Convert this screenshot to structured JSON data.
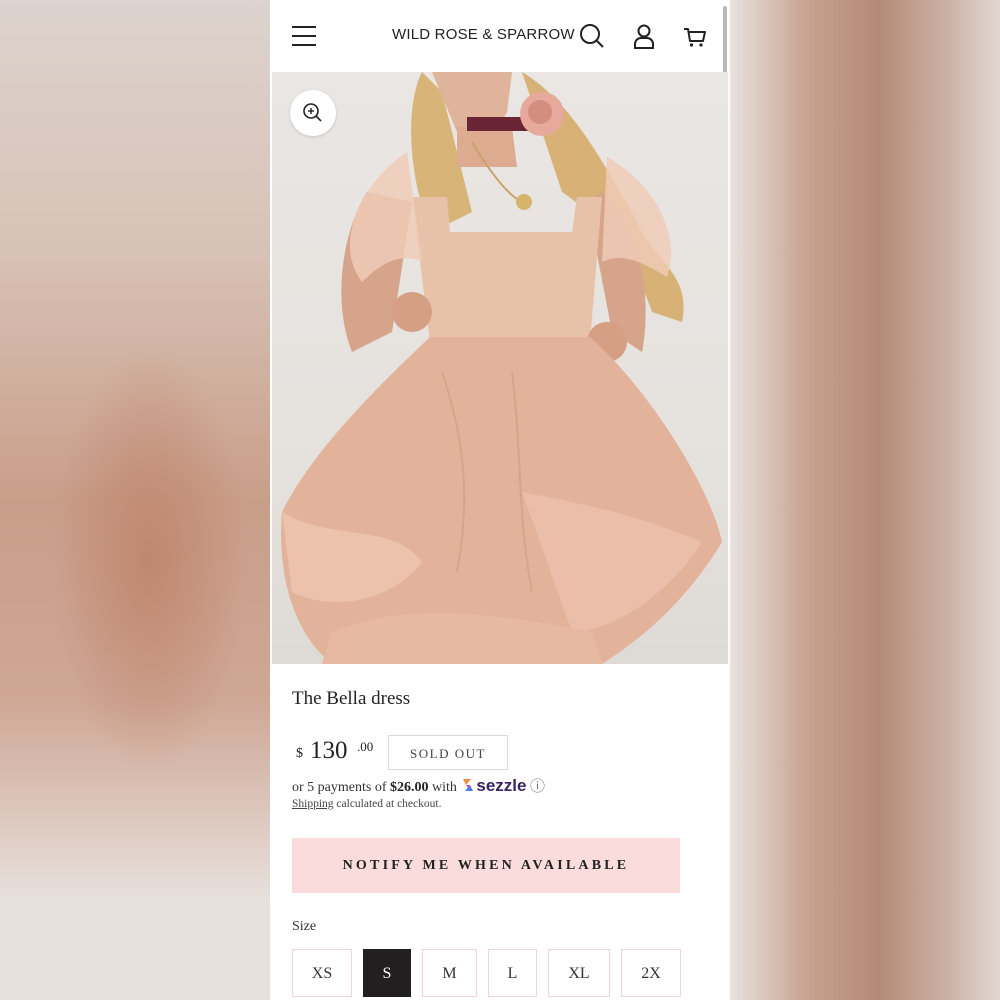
{
  "header": {
    "brand": "WILD ROSE & SPARROW",
    "menu_icon": "hamburger-menu-icon",
    "search_icon": "search-icon",
    "account_icon": "user-icon",
    "cart_icon": "cart-icon"
  },
  "product": {
    "title": "The Bella dress",
    "price_currency": "$",
    "price_whole": "130",
    "price_cents": ".00",
    "badge": "SOLD OUT",
    "installments_prefix": "or 5 payments of",
    "installments_amount": "$26.00",
    "installments_with": "with",
    "installments_provider": "sezzle",
    "info_glyph": "ⓘ",
    "shipping_link": "Shipping",
    "shipping_text": "calculated at checkout.",
    "notify_label": "NOTIFY ME WHEN AVAILABLE",
    "size_label": "Size",
    "sizes": [
      "XS",
      "S",
      "M",
      "L",
      "XL",
      "2X"
    ],
    "selected_size": "S"
  },
  "colors": {
    "notify_bg": "#fbdcdc",
    "active_size_bg": "#231f20",
    "dress": "#e3b29a"
  }
}
